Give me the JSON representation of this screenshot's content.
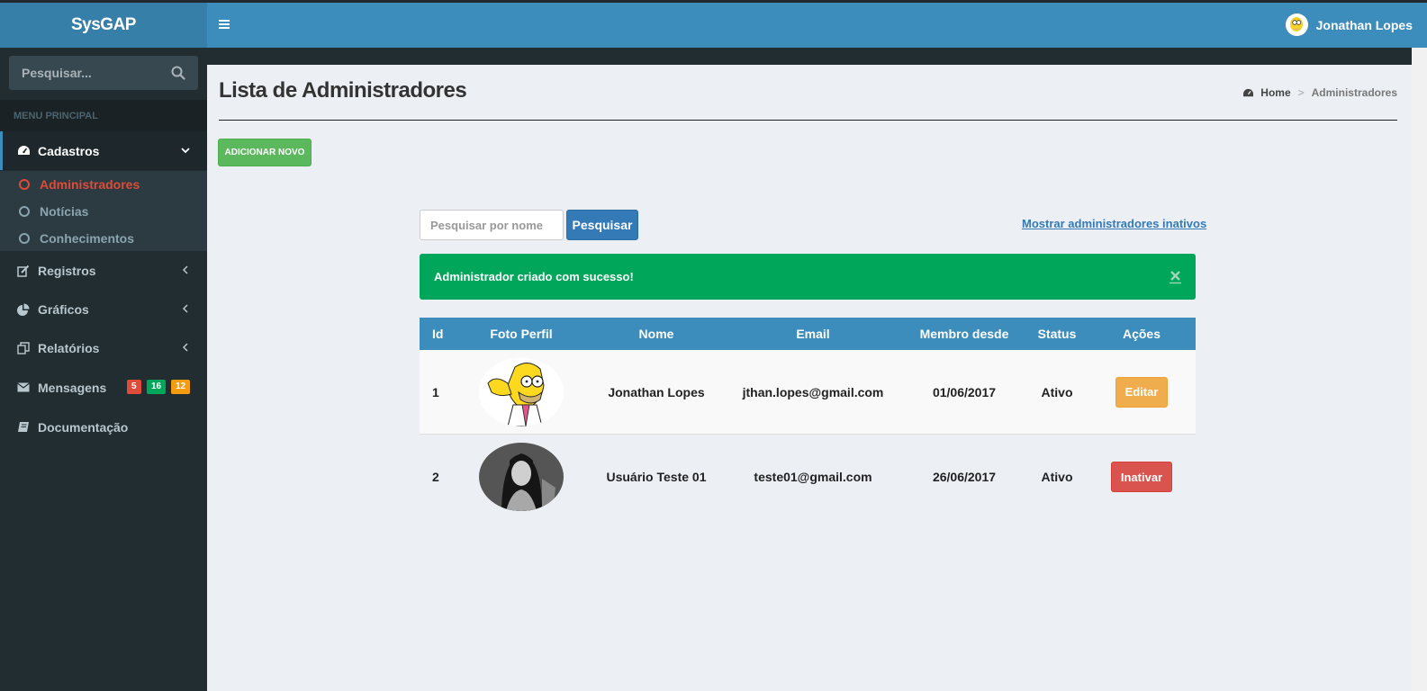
{
  "app": {
    "brand": "SysGAP"
  },
  "header": {
    "user_name": "Jonathan Lopes"
  },
  "sidebar": {
    "search_placeholder": "Pesquisar...",
    "menu_header": "MENU PRINCIPAL",
    "items": [
      {
        "label": "Cadastros",
        "icon": "dashboard-icon"
      },
      {
        "label": "Registros",
        "icon": "edit-icon"
      },
      {
        "label": "Gráficos",
        "icon": "pie-chart-icon"
      },
      {
        "label": "Relatórios",
        "icon": "copy-icon"
      },
      {
        "label": "Mensagens",
        "icon": "envelope-icon"
      },
      {
        "label": "Documentação",
        "icon": "book-icon"
      }
    ],
    "submenu": [
      "Administradores",
      "Notícias",
      "Conhecimentos"
    ],
    "badges": [
      {
        "value": "5",
        "color": "#dd4b39"
      },
      {
        "value": "16",
        "color": "#00a65a"
      },
      {
        "value": "12",
        "color": "#f39c12"
      }
    ]
  },
  "content": {
    "title": "Lista de Administradores",
    "breadcrumb": {
      "home": "Home",
      "current": "Administradores"
    },
    "add_button": "ADICIONAR NOVO",
    "search_placeholder": "Pesquisar por nome",
    "search_button": "Pesquisar",
    "inactive_link": "Mostrar administradores inativos",
    "alert": "Administrador criado com sucesso!"
  },
  "table": {
    "headers": [
      "Id",
      "Foto Perfil",
      "Nome",
      "Email",
      "Membro desde",
      "Status",
      "Ações"
    ],
    "rows": [
      {
        "id": "1",
        "nome": "Jonathan Lopes",
        "email": "jthan.lopes@gmail.com",
        "desde": "01/06/2017",
        "status": "Ativo",
        "acao": "Editar"
      },
      {
        "id": "2",
        "nome": "Usuário Teste 01",
        "email": "teste01@gmail.com",
        "desde": "26/06/2017",
        "status": "Ativo",
        "acao": "Inativar"
      }
    ]
  },
  "colors": {
    "header": "#3c8dbc",
    "logo": "#367fa9",
    "sidebar": "#222d32",
    "success": "#00a65a",
    "add_button": "#5cb85c",
    "primary": "#337ab7",
    "warning": "#f0ad4e",
    "danger": "#d9534f"
  }
}
